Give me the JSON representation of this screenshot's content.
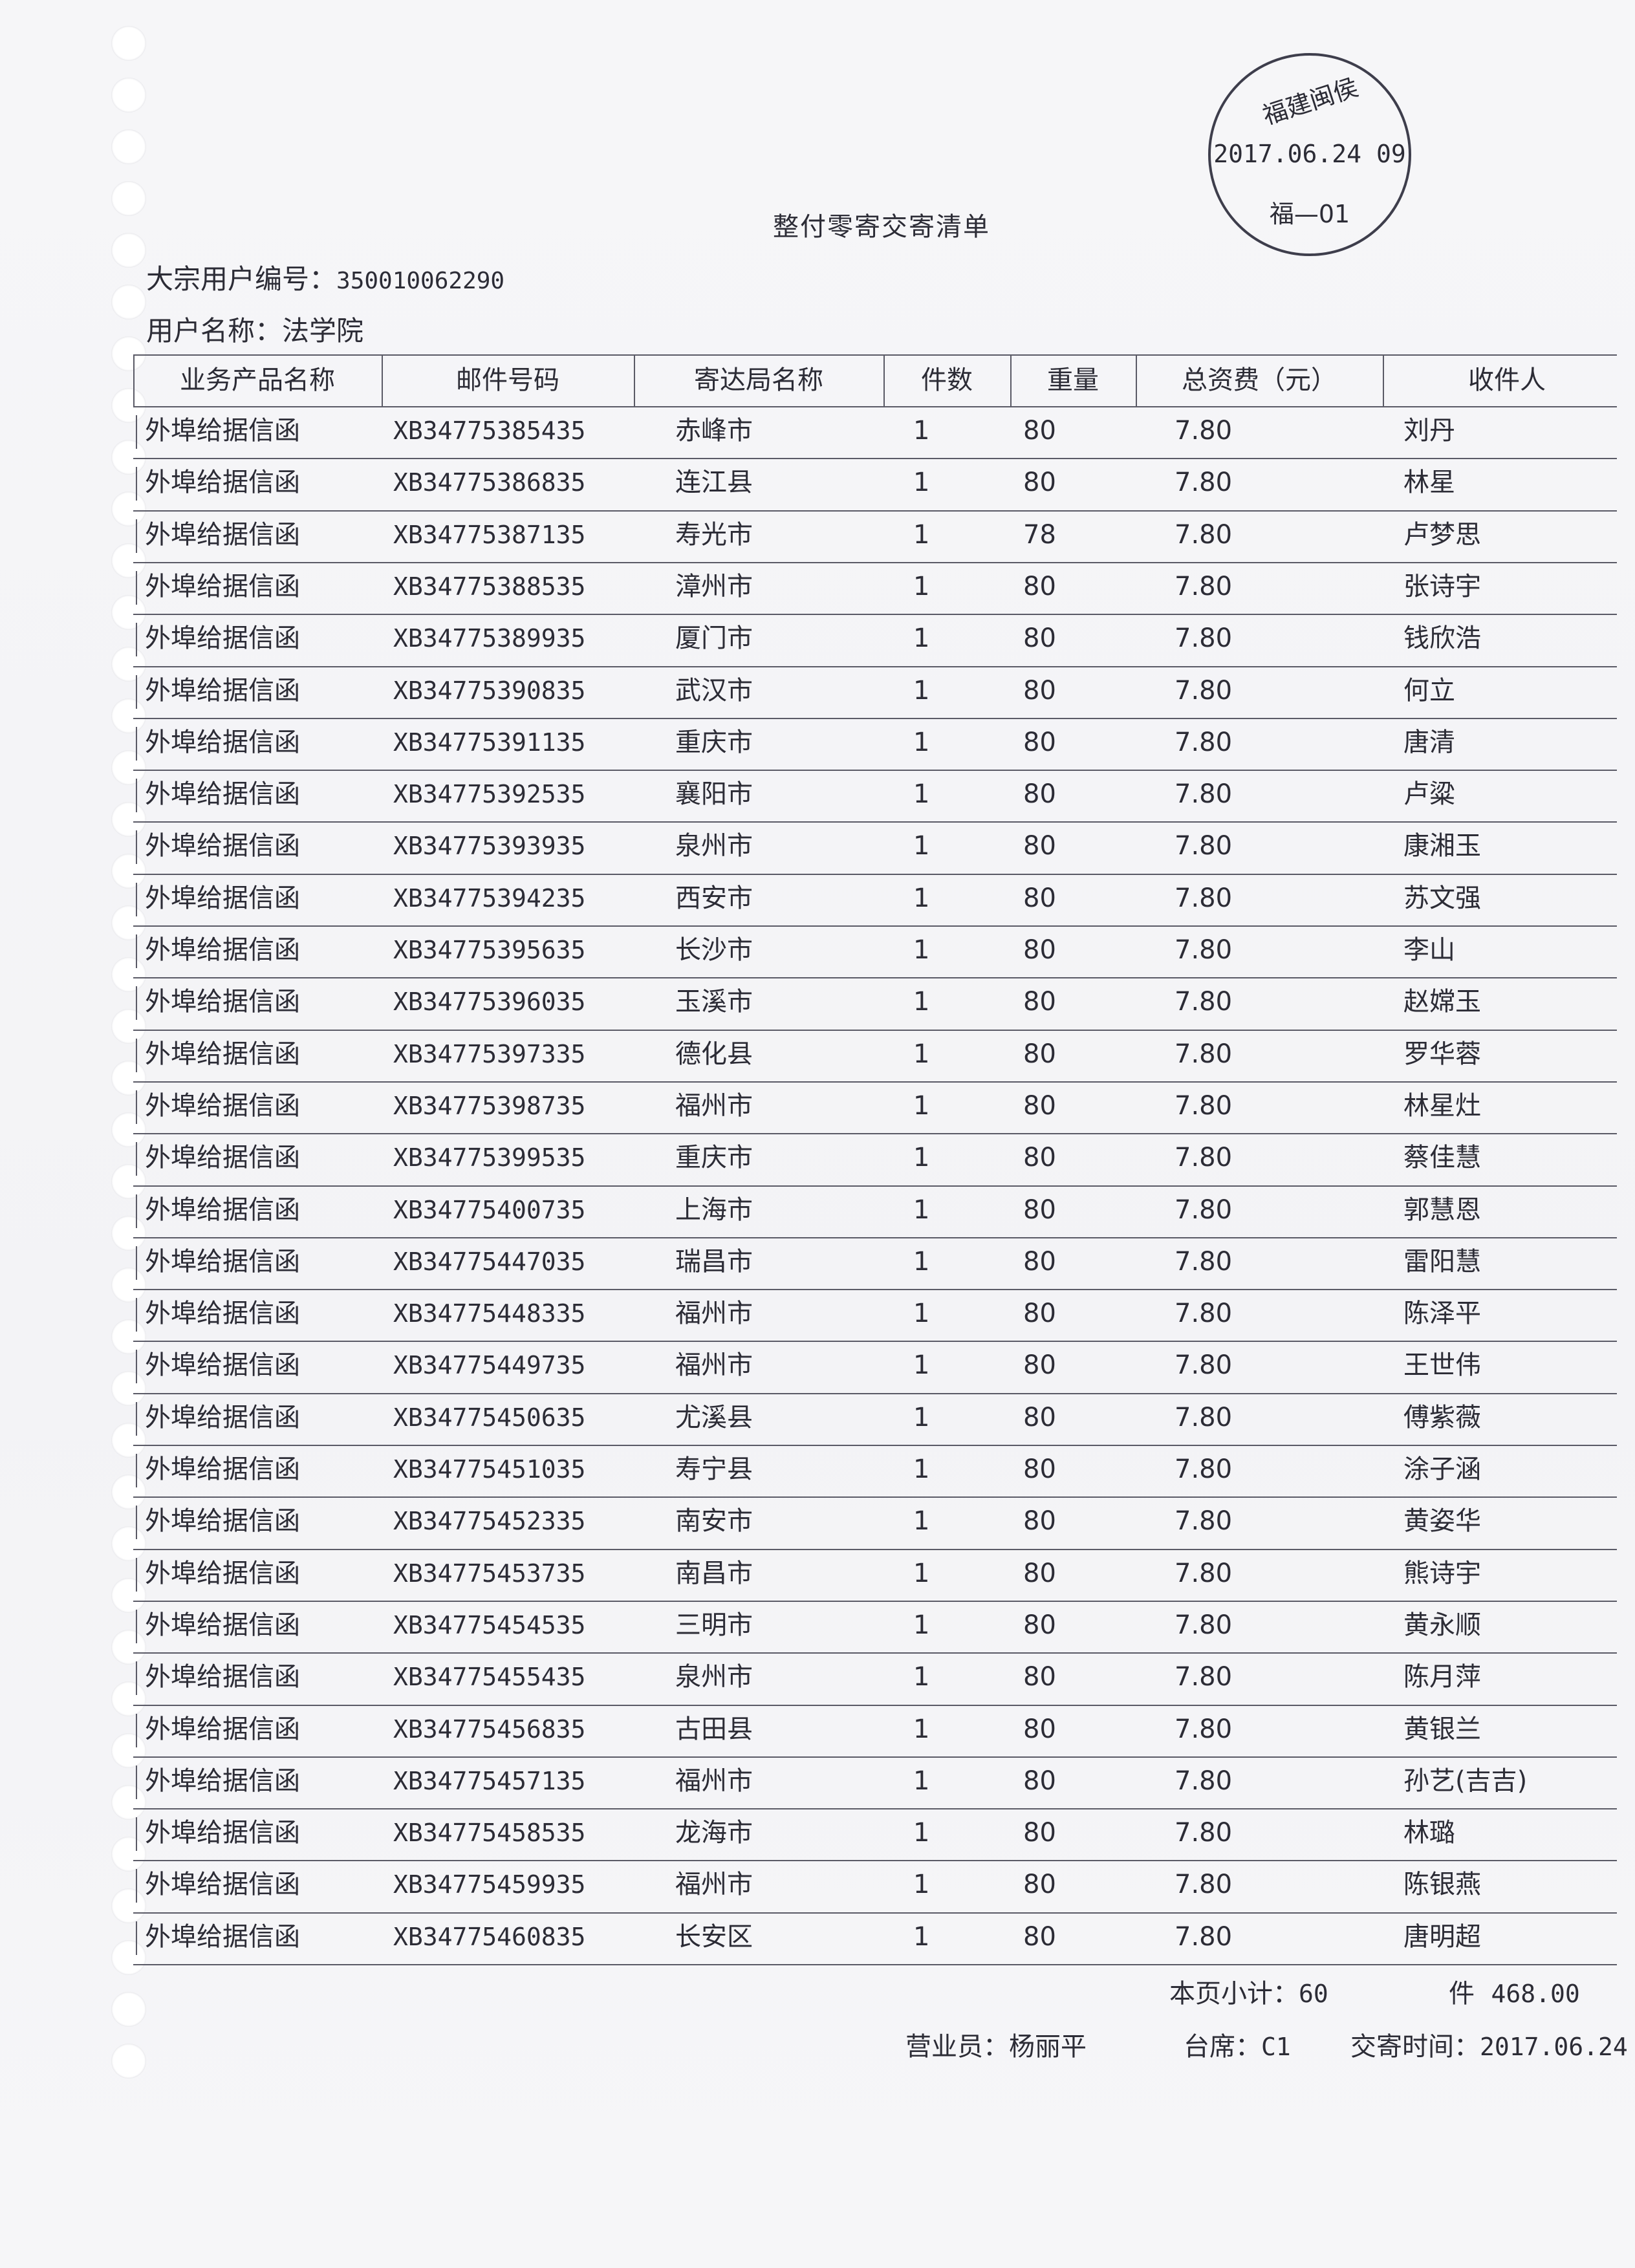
{
  "title": "整付零寄交寄清单",
  "account": {
    "number_label": "大宗用户编号：",
    "number": "350010062290",
    "name_label": "用户名称：",
    "name": "法学院"
  },
  "stamp": {
    "top": "福建闽侯",
    "datetime": "2017.06.24 09",
    "bottom": "福—01"
  },
  "table": {
    "headers": [
      "业务产品名称",
      "邮件号码",
      "寄达局名称",
      "件数",
      "重量",
      "总资费（元）",
      "收件人"
    ],
    "rows": [
      [
        "外埠给据信函",
        "XB34775385435",
        "赤峰市",
        "1",
        "80",
        "7.80",
        "刘丹"
      ],
      [
        "外埠给据信函",
        "XB34775386835",
        "连江县",
        "1",
        "80",
        "7.80",
        "林星"
      ],
      [
        "外埠给据信函",
        "XB34775387135",
        "寿光市",
        "1",
        "78",
        "7.80",
        "卢梦思"
      ],
      [
        "外埠给据信函",
        "XB34775388535",
        "漳州市",
        "1",
        "80",
        "7.80",
        "张诗宇"
      ],
      [
        "外埠给据信函",
        "XB34775389935",
        "厦门市",
        "1",
        "80",
        "7.80",
        "钱欣浩"
      ],
      [
        "外埠给据信函",
        "XB34775390835",
        "武汉市",
        "1",
        "80",
        "7.80",
        "何立"
      ],
      [
        "外埠给据信函",
        "XB34775391135",
        "重庆市",
        "1",
        "80",
        "7.80",
        "唐清"
      ],
      [
        "外埠给据信函",
        "XB34775392535",
        "襄阳市",
        "1",
        "80",
        "7.80",
        "卢粱"
      ],
      [
        "外埠给据信函",
        "XB34775393935",
        "泉州市",
        "1",
        "80",
        "7.80",
        "康湘玉"
      ],
      [
        "外埠给据信函",
        "XB34775394235",
        "西安市",
        "1",
        "80",
        "7.80",
        "苏文强"
      ],
      [
        "外埠给据信函",
        "XB34775395635",
        "长沙市",
        "1",
        "80",
        "7.80",
        "李山"
      ],
      [
        "外埠给据信函",
        "XB34775396035",
        "玉溪市",
        "1",
        "80",
        "7.80",
        "赵嫦玉"
      ],
      [
        "外埠给据信函",
        "XB34775397335",
        "德化县",
        "1",
        "80",
        "7.80",
        "罗华蓉"
      ],
      [
        "外埠给据信函",
        "XB34775398735",
        "福州市",
        "1",
        "80",
        "7.80",
        "林星灶"
      ],
      [
        "外埠给据信函",
        "XB34775399535",
        "重庆市",
        "1",
        "80",
        "7.80",
        "蔡佳慧"
      ],
      [
        "外埠给据信函",
        "XB34775400735",
        "上海市",
        "1",
        "80",
        "7.80",
        "郭慧恩"
      ],
      [
        "外埠给据信函",
        "XB34775447035",
        "瑞昌市",
        "1",
        "80",
        "7.80",
        "雷阳慧"
      ],
      [
        "外埠给据信函",
        "XB34775448335",
        "福州市",
        "1",
        "80",
        "7.80",
        "陈泽平"
      ],
      [
        "外埠给据信函",
        "XB34775449735",
        "福州市",
        "1",
        "80",
        "7.80",
        "王世伟"
      ],
      [
        "外埠给据信函",
        "XB34775450635",
        "尤溪县",
        "1",
        "80",
        "7.80",
        "傅紫薇"
      ],
      [
        "外埠给据信函",
        "XB34775451035",
        "寿宁县",
        "1",
        "80",
        "7.80",
        "涂子涵"
      ],
      [
        "外埠给据信函",
        "XB34775452335",
        "南安市",
        "1",
        "80",
        "7.80",
        "黄姿华"
      ],
      [
        "外埠给据信函",
        "XB34775453735",
        "南昌市",
        "1",
        "80",
        "7.80",
        "熊诗宇"
      ],
      [
        "外埠给据信函",
        "XB34775454535",
        "三明市",
        "1",
        "80",
        "7.80",
        "黄永顺"
      ],
      [
        "外埠给据信函",
        "XB34775455435",
        "泉州市",
        "1",
        "80",
        "7.80",
        "陈月萍"
      ],
      [
        "外埠给据信函",
        "XB34775456835",
        "古田县",
        "1",
        "80",
        "7.80",
        "黄银兰"
      ],
      [
        "外埠给据信函",
        "XB34775457135",
        "福州市",
        "1",
        "80",
        "7.80",
        "孙艺(吉吉)"
      ],
      [
        "外埠给据信函",
        "XB34775458535",
        "龙海市",
        "1",
        "80",
        "7.80",
        "林璐"
      ],
      [
        "外埠给据信函",
        "XB34775459935",
        "福州市",
        "1",
        "80",
        "7.80",
        "陈银燕"
      ],
      [
        "外埠给据信函",
        "XB34775460835",
        "长安区",
        "1",
        "80",
        "7.80",
        "唐明超"
      ]
    ]
  },
  "summary": {
    "subtotal_label": "本页小计：",
    "subtotal_count": "60",
    "subtotal_unit": "件",
    "subtotal_amount": "468.00"
  },
  "footer": {
    "clerk_label": "营业员：",
    "clerk": "杨丽平",
    "counter_label": "台席：",
    "counter": "C1",
    "time_label": "交寄时间：",
    "time": "2017.06.24"
  }
}
